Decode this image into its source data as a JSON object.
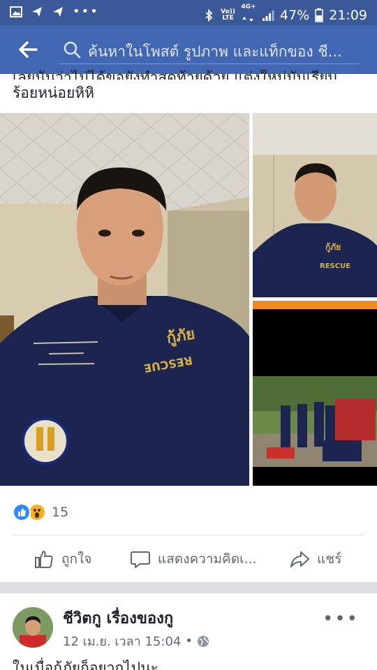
{
  "status_bar": {
    "volte_top": "Vo))",
    "volte_bottom": "LTE",
    "net_top": "4G+",
    "battery": "47%",
    "time": "21:09"
  },
  "header": {
    "search_placeholder": "ค้นหาในโพสต์ รูปภาพ และแท็กของ ชี..."
  },
  "post": {
    "text_clipped": "เลยนั้นว่าไม่ได้ขอยังทำสุดท้ายด้วย แต่งใหม่มันเรียบ",
    "text_line2": "ร้อยหน่อยหิหิ",
    "reactions_count": "15",
    "actions": {
      "like": "ถูกใจ",
      "comment": "แสดงความคิดเ...",
      "share": "แชร์"
    },
    "photo_tr_patch": "กู้ภัย",
    "photo_tr_rescue": "RESCUE",
    "photo_main_patch": "กู้ภัย",
    "photo_main_rescue": "RESCUE"
  },
  "next_post": {
    "author": "ชีวิตกู เรื่องของกู",
    "timestamp": "12 เม.ย. เวลา 15:04",
    "text_clipped": "ในเมื่อกู้ภัยก็อยากไปนะ ..."
  },
  "colors": {
    "brand": "#4267b2",
    "status_bar": "#3b5998",
    "uniform": "#1c2550"
  }
}
